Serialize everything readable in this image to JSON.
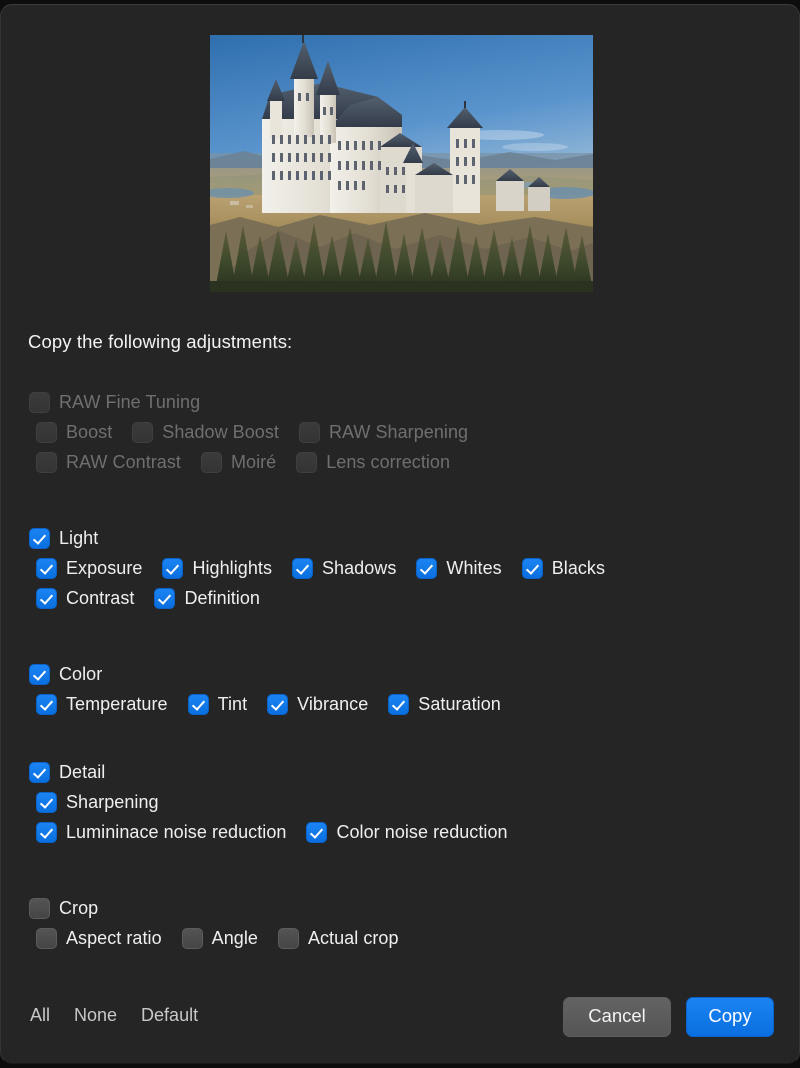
{
  "dialog": {
    "heading": "Copy the following adjustments:",
    "thumbnail_alt": "Neuschwanstein Castle photo preview"
  },
  "colors": {
    "accent": "#0a74ea",
    "background": "#252525",
    "label": "#efefef",
    "label_disabled": "#6f6f6f",
    "checkbox_off": "#4a4a4a",
    "cancel_button": "#5a5a5a"
  },
  "groups": [
    {
      "id": "raw-fine-tuning",
      "header": {
        "label": "RAW Fine Tuning",
        "checked": false,
        "enabled": false
      },
      "rows": [
        [
          {
            "label": "Boost",
            "checked": false,
            "enabled": false
          },
          {
            "label": "Shadow Boost",
            "checked": false,
            "enabled": false
          },
          {
            "label": "RAW Sharpening",
            "checked": false,
            "enabled": false
          }
        ],
        [
          {
            "label": "RAW Contrast",
            "checked": false,
            "enabled": false
          },
          {
            "label": "Moiré",
            "checked": false,
            "enabled": false
          },
          {
            "label": "Lens correction",
            "checked": false,
            "enabled": false
          }
        ]
      ]
    },
    {
      "id": "light",
      "header": {
        "label": "Light",
        "checked": true,
        "enabled": true
      },
      "rows": [
        [
          {
            "label": "Exposure",
            "checked": true,
            "enabled": true
          },
          {
            "label": "Highlights",
            "checked": true,
            "enabled": true
          },
          {
            "label": "Shadows",
            "checked": true,
            "enabled": true
          },
          {
            "label": "Whites",
            "checked": true,
            "enabled": true
          },
          {
            "label": "Blacks",
            "checked": true,
            "enabled": true
          }
        ],
        [
          {
            "label": "Contrast",
            "checked": true,
            "enabled": true
          },
          {
            "label": "Definition",
            "checked": true,
            "enabled": true
          }
        ]
      ]
    },
    {
      "id": "color",
      "header": {
        "label": "Color",
        "checked": true,
        "enabled": true
      },
      "rows": [
        [
          {
            "label": "Temperature",
            "checked": true,
            "enabled": true
          },
          {
            "label": "Tint",
            "checked": true,
            "enabled": true
          },
          {
            "label": "Vibrance",
            "checked": true,
            "enabled": true
          },
          {
            "label": "Saturation",
            "checked": true,
            "enabled": true
          }
        ]
      ]
    },
    {
      "id": "detail",
      "header": {
        "label": "Detail",
        "checked": true,
        "enabled": true
      },
      "rows": [
        [
          {
            "label": "Sharpening",
            "checked": true,
            "enabled": true
          }
        ],
        [
          {
            "label": "Lumininace noise reduction",
            "checked": true,
            "enabled": true
          },
          {
            "label": "Color noise reduction",
            "checked": true,
            "enabled": true
          }
        ]
      ]
    },
    {
      "id": "crop",
      "header": {
        "label": "Crop",
        "checked": false,
        "enabled": true
      },
      "rows": [
        [
          {
            "label": "Aspect ratio",
            "checked": false,
            "enabled": true
          },
          {
            "label": "Angle",
            "checked": false,
            "enabled": true
          },
          {
            "label": "Actual crop",
            "checked": false,
            "enabled": true
          }
        ]
      ]
    }
  ],
  "footer": {
    "links": [
      "All",
      "None",
      "Default"
    ],
    "cancel_label": "Cancel",
    "copy_label": "Copy"
  }
}
